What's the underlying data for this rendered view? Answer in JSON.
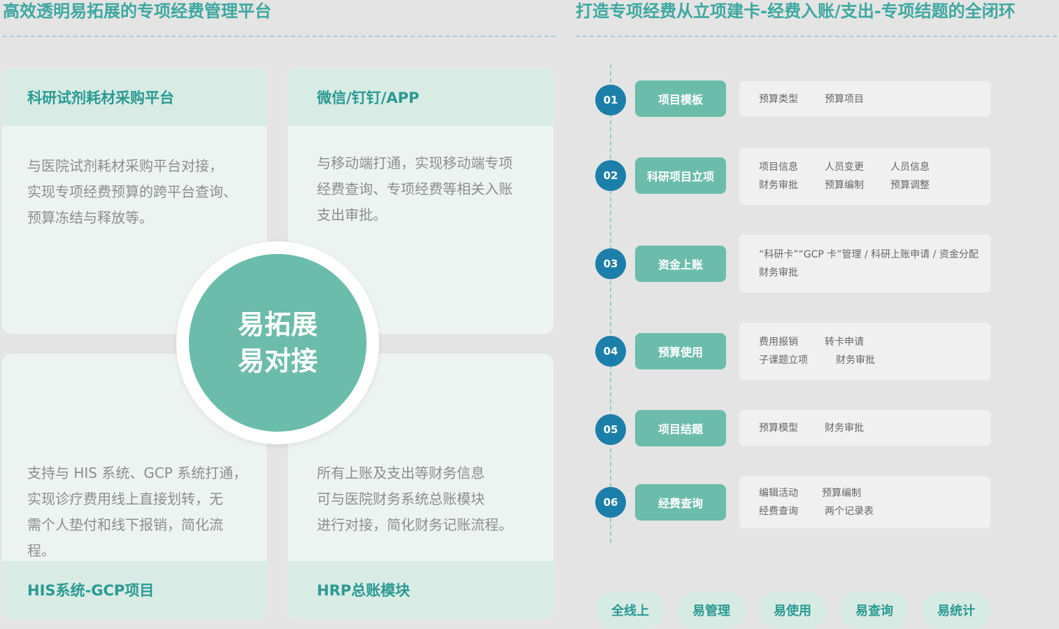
{
  "left_title": "高效透明易拓展的专项经费管理平台",
  "right_title": "打造专项经费从立项建卡-经费入账/支出-专项结题的全闭环",
  "cards": {
    "top_left": {
      "heading": "科研试剂耗材采购平台",
      "desc": [
        "与医院试剂耗材采购平台对接，",
        "实现专项经费预算的跨平台查询、",
        "预算冻结与释放等。"
      ]
    },
    "top_right": {
      "heading": "微信/钉钉/APP",
      "desc": [
        "与移动端打通，实现移动端专项",
        "经费查询、专项经费等相关入账",
        "支出审批。"
      ]
    },
    "bottom_left": {
      "heading": "HIS系统-GCP项目",
      "desc": [
        "支持与 HIS 系统、GCP 系统打通，",
        "实现诊疗费用线上直接划转，无",
        "需个人垫付和线下报销，简化流",
        "程。"
      ]
    },
    "bottom_right": {
      "heading": "HRP总账模块",
      "desc": [
        "所有上账及支出等财务信息",
        "可与医院财务系统总账模块",
        "进行对接，简化财务记账流程。"
      ]
    }
  },
  "center": {
    "line1": "易拓展",
    "line2": "易对接"
  },
  "steps": [
    {
      "num": "01",
      "label": "项目模板",
      "items": [
        [
          "预算类型",
          "预算项目"
        ]
      ]
    },
    {
      "num": "02",
      "label": "科研项目立项",
      "items": [
        [
          "项目信息",
          "人员变更",
          "人员信息"
        ],
        [
          "财务审批",
          "预算编制",
          "预算调整"
        ]
      ]
    },
    {
      "num": "03",
      "label": "资金上账",
      "items": [
        [
          "“科研卡”“GCP 卡”管理 / 科研上账申请 / 资金分配"
        ],
        [
          "财务审批"
        ]
      ]
    },
    {
      "num": "04",
      "label": "预算使用",
      "items": [
        [
          "费用报销",
          "转卡申请"
        ],
        [
          "子课题立项",
          "财务审批"
        ]
      ]
    },
    {
      "num": "05",
      "label": "项目结题",
      "items": [
        [
          "预算模型",
          "财务审批"
        ]
      ]
    },
    {
      "num": "06",
      "label": "经费查询",
      "items": [
        [
          "编辑活动",
          "预算编制"
        ],
        [
          "经费查询",
          "两个记录表"
        ]
      ]
    }
  ],
  "tags": [
    "全线上",
    "易管理",
    "易使用",
    "易查询",
    "易统计"
  ]
}
